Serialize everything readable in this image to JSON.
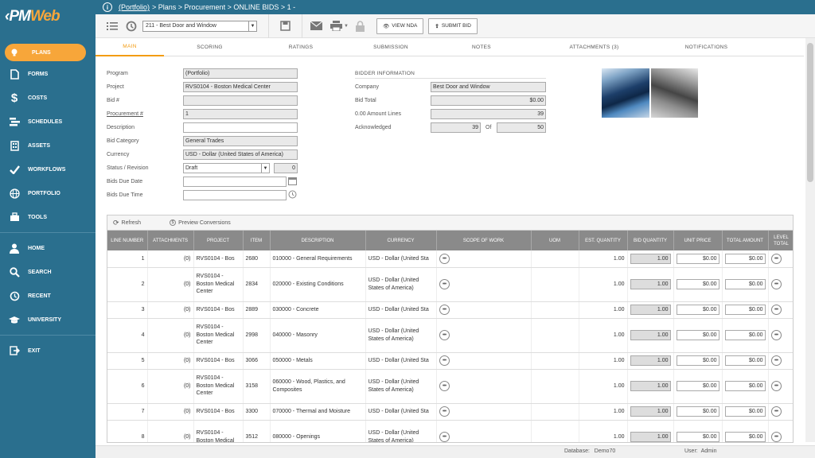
{
  "app": {
    "logo_prefix": "‹PM",
    "logo_suffix": "Web"
  },
  "sidebar": {
    "items": [
      {
        "label": "PLANS",
        "icon": "lightbulb-icon"
      },
      {
        "label": "FORMS",
        "icon": "document-icon"
      },
      {
        "label": "COSTS",
        "icon": "dollar-icon"
      },
      {
        "label": "SCHEDULES",
        "icon": "schedule-bars-icon"
      },
      {
        "label": "ASSETS",
        "icon": "building-icon"
      },
      {
        "label": "WORKFLOWS",
        "icon": "checkmark-icon"
      },
      {
        "label": "PORTFOLIO",
        "icon": "globe-icon"
      },
      {
        "label": "TOOLS",
        "icon": "toolbox-icon"
      },
      {
        "label": "HOME",
        "icon": "user-icon"
      },
      {
        "label": "SEARCH",
        "icon": "search-icon"
      },
      {
        "label": "RECENT",
        "icon": "history-icon"
      },
      {
        "label": "UNIVERSITY",
        "icon": "graduation-cap-icon"
      },
      {
        "label": "EXIT",
        "icon": "exit-icon"
      }
    ]
  },
  "breadcrumb": {
    "link": "(Portfolio)",
    "rest": "> Plans > Procurement > ONLINE BIDS > 1 -"
  },
  "toolbar": {
    "record_select": "211 - Best Door and Window",
    "view_nda": "VIEW NDA",
    "submit_bid": "SUBMIT BID"
  },
  "tabs": [
    "MAIN",
    "SCORING",
    "RATINGS",
    "SUBMISSION",
    "NOTES",
    "ATTACHMENTS (3)",
    "NOTIFICATIONS"
  ],
  "form": {
    "program_label": "Program",
    "program": "(Portfolio)",
    "project_label": "Project",
    "project": "RVS0104 - Boston Medical Center",
    "bid_no_label": "Bid #",
    "bid_no": "",
    "procurement_label": "Procurement #",
    "procurement": "1",
    "description_label": "Description",
    "description": "",
    "bid_category_label": "Bid Category",
    "bid_category": "General Trades",
    "currency_label": "Currency",
    "currency": "USD - Dollar (United States of America)",
    "status_label": "Status / Revision",
    "status": "Draft",
    "revision": "0",
    "due_date_label": "Bids Due Date",
    "due_date": "",
    "due_time_label": "Bids Due Time",
    "due_time": "",
    "bidder_section": "BIDDER INFORMATION",
    "company_label": "Company",
    "company": "Best Door and Window",
    "bid_total_label": "Bid Total",
    "bid_total": "$0.00",
    "amount_lines_label": "0.00 Amount Lines",
    "amount_lines": "39",
    "acknowledged_label": "Acknowledged",
    "acknowledged": "39",
    "of_label": "Of",
    "of_total": "50"
  },
  "grid": {
    "refresh": "Refresh",
    "preview": "Preview Conversions",
    "headers": [
      "LINE NUMBER",
      "ATTACHMENTS",
      "PROJECT",
      "ITEM",
      "DESCRIPTION",
      "CURRENCY",
      "SCOPE OF WORK",
      "UOM",
      "EST. QUANTITY",
      "BID QUANTITY",
      "UNIT PRICE",
      "TOTAL AMOUNT",
      "LEVEL TOTAL"
    ],
    "rows": [
      {
        "line": "1",
        "att": "(0)",
        "project": "RVS0104 - Bos",
        "item": "2680",
        "desc": "010000 - General Requirements",
        "currency": "USD - Dollar (United Sta",
        "est": "1.00",
        "bid_qty": "1.00",
        "unit": "$0.00",
        "total": "$0.00",
        "tall": false
      },
      {
        "line": "2",
        "att": "(0)",
        "project": "RVS0104 - Boston Medical Center",
        "item": "2834",
        "desc": "020000 - Existing Conditions",
        "currency": "USD - Dollar (United States of America)",
        "est": "1.00",
        "bid_qty": "1.00",
        "unit": "$0.00",
        "total": "$0.00",
        "tall": true
      },
      {
        "line": "3",
        "att": "(0)",
        "project": "RVS0104 - Bos",
        "item": "2889",
        "desc": "030000 - Concrete",
        "currency": "USD - Dollar (United Sta",
        "est": "1.00",
        "bid_qty": "1.00",
        "unit": "$0.00",
        "total": "$0.00",
        "tall": false
      },
      {
        "line": "4",
        "att": "(0)",
        "project": "RVS0104 - Boston Medical Center",
        "item": "2998",
        "desc": "040000 - Masonry",
        "currency": "USD - Dollar (United States of America)",
        "est": "1.00",
        "bid_qty": "1.00",
        "unit": "$0.00",
        "total": "$0.00",
        "tall": true
      },
      {
        "line": "5",
        "att": "(0)",
        "project": "RVS0104 - Bos",
        "item": "3066",
        "desc": "050000 - Metals",
        "currency": "USD - Dollar (United Sta",
        "est": "1.00",
        "bid_qty": "1.00",
        "unit": "$0.00",
        "total": "$0.00",
        "tall": false
      },
      {
        "line": "6",
        "att": "(0)",
        "project": "RVS0104 - Boston Medical Center",
        "item": "3158",
        "desc": "060000 - Wood, Plastics, and Composites",
        "currency": "USD - Dollar (United States of America)",
        "est": "1.00",
        "bid_qty": "1.00",
        "unit": "$0.00",
        "total": "$0.00",
        "tall": true
      },
      {
        "line": "7",
        "att": "(0)",
        "project": "RVS0104 - Bos",
        "item": "3300",
        "desc": "070000 - Thermal and Moisture",
        "currency": "USD - Dollar (United Sta",
        "est": "1.00",
        "bid_qty": "1.00",
        "unit": "$0.00",
        "total": "$0.00",
        "tall": false
      },
      {
        "line": "8",
        "att": "(0)",
        "project": "RVS0104 - Boston Medical",
        "item": "3512",
        "desc": "080000 - Openings",
        "currency": "USD - Dollar (United States of America)",
        "est": "1.00",
        "bid_qty": "1.00",
        "unit": "$0.00",
        "total": "$0.00",
        "tall": true
      }
    ]
  },
  "status": {
    "database_label": "Database:",
    "database": "Demo70",
    "user_label": "User:",
    "user": "Admin"
  }
}
